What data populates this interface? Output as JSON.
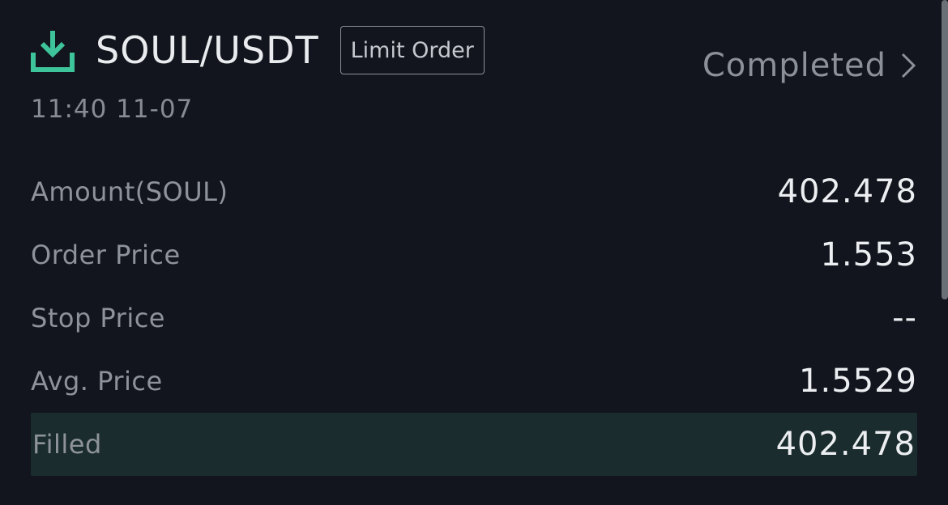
{
  "header": {
    "pair": "SOUL/USDT",
    "order_type": "Limit Order",
    "status": "Completed",
    "time": "11:40 11-07",
    "icon": "download-icon",
    "accent_color": "#3ec49a"
  },
  "details": [
    {
      "label": "Amount(SOUL)",
      "value": "402.478"
    },
    {
      "label": "Order Price",
      "value": "1.553"
    },
    {
      "label": "Stop Price",
      "value": "--"
    },
    {
      "label": "Avg. Price",
      "value": "1.5529"
    },
    {
      "label": "Filled",
      "value": "402.478"
    }
  ]
}
